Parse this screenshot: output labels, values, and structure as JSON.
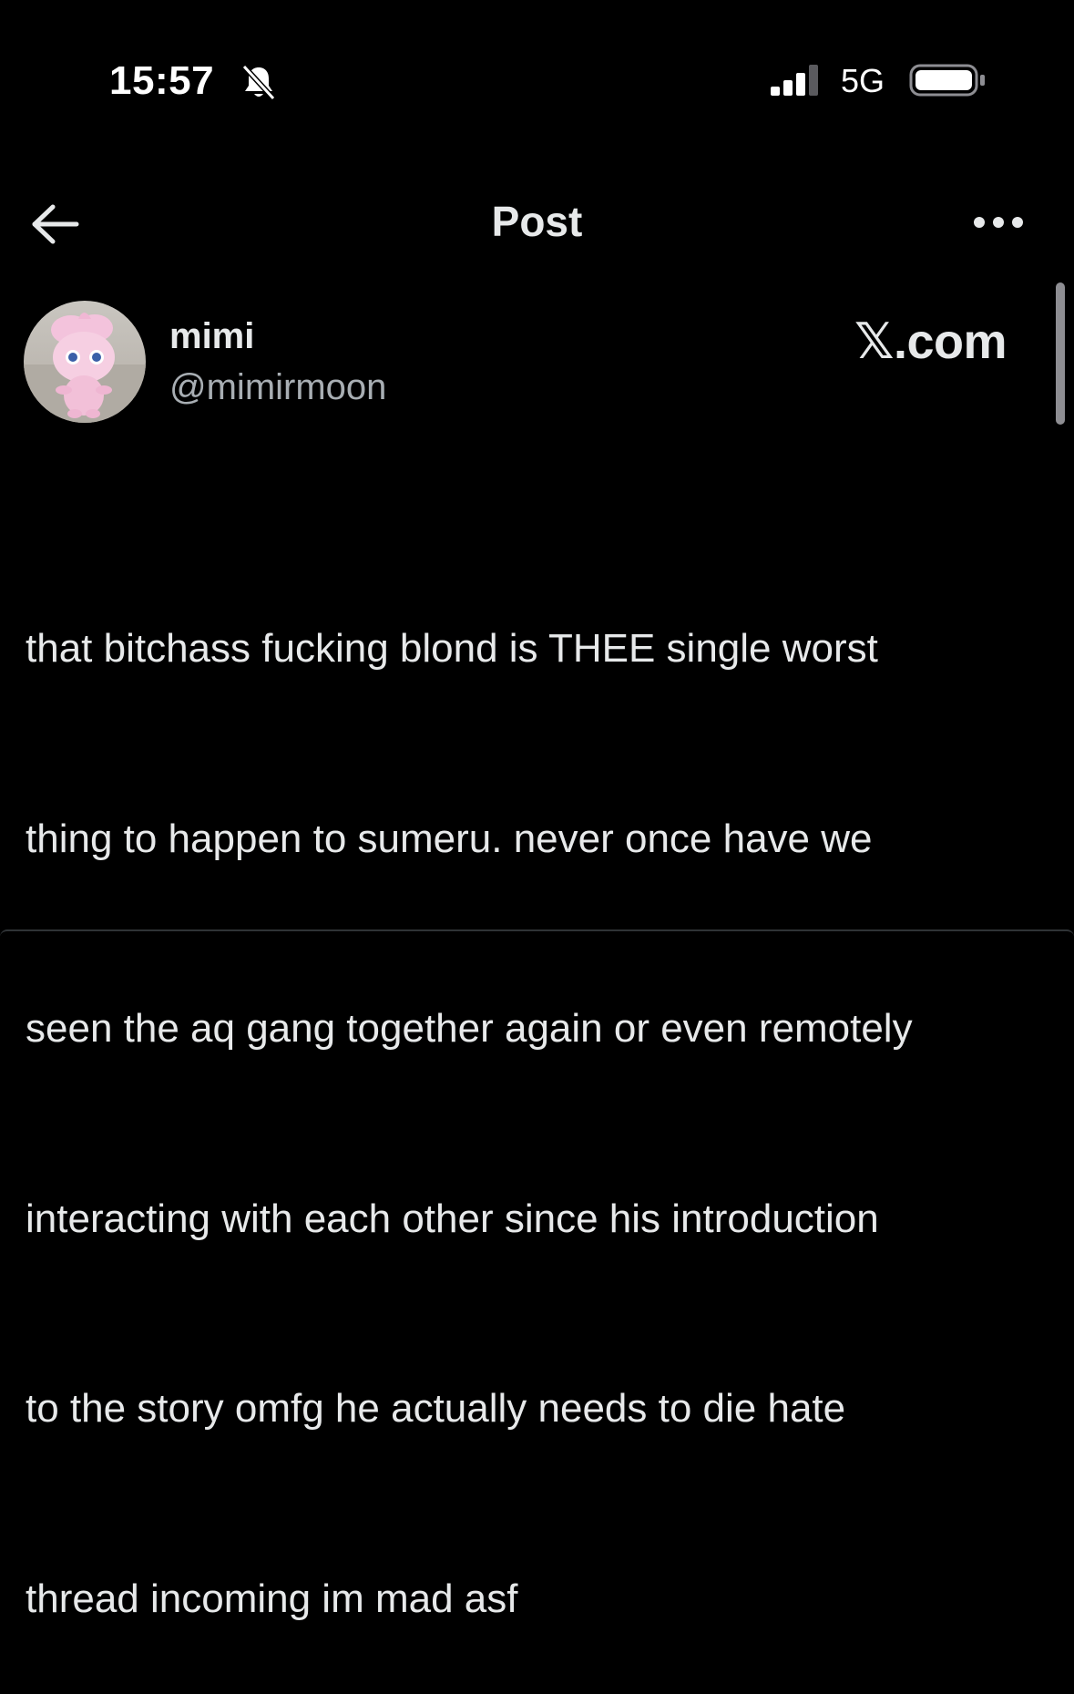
{
  "status_bar": {
    "time": "15:57",
    "network": "5G",
    "bell_icon": "bell-slash-icon",
    "signal_icon": "cellular-signal-icon",
    "battery_icon": "battery-icon"
  },
  "header": {
    "title": "Post",
    "back_icon": "arrow-left-icon",
    "more_icon": "more-horizontal-icon"
  },
  "author": {
    "display_name": "mimi",
    "handle": "@mimirmoon"
  },
  "watermark": "𝕏.com",
  "post": {
    "lines": [
      "that bitchass fucking blond is THEE single worst",
      "thing to happen to sumeru. never once have we",
      "seen the aq gang together again or even remotely",
      "interacting with each other since his introduction",
      "to the story omfg he actually needs to die hate",
      "thread incoming im mad asf"
    ]
  },
  "colors": {
    "background": "#000000",
    "primary_text": "#e7e9ea",
    "secondary_text": "#a8aeb3"
  }
}
